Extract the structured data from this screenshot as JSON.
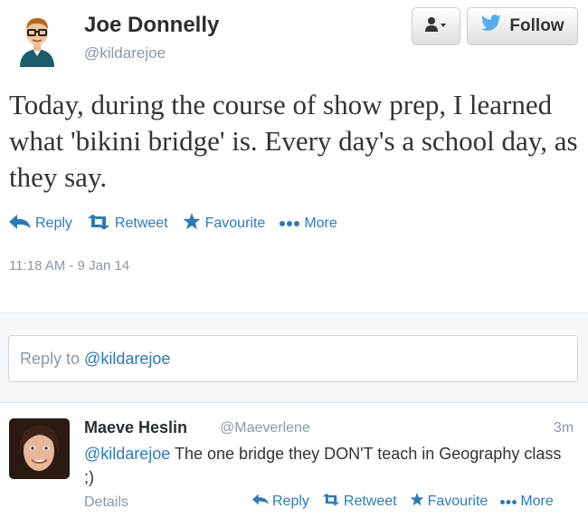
{
  "author": {
    "name": "Joe Donnelly",
    "handle": "@kildarejoe"
  },
  "buttons": {
    "follow_label": "Follow"
  },
  "tweet": {
    "text": "Today, during the course of show prep, I learned what 'bikini bridge' is. Every day's a school day, as they say.",
    "timestamp": "11:18 AM - 9 Jan 14"
  },
  "actions": {
    "reply": "Reply",
    "retweet": "Retweet",
    "favourite": "Favourite",
    "more": "More"
  },
  "reply_box": {
    "prefix": "Reply to",
    "mention": "@kildarejoe"
  },
  "reply_tweet": {
    "name": "Maeve Heslin",
    "handle": "@Maeverlene",
    "time": "3m",
    "mention": "@kildarejoe",
    "text": " The one bridge they DON'T teach in Geography class ;)",
    "details": "Details"
  },
  "colors": {
    "link": "#2b7bb9",
    "muted": "#8899a6",
    "twitter_blue": "#55acee"
  },
  "icons": [
    "user-dropdown-icon",
    "twitter-bird-icon",
    "reply-icon",
    "retweet-icon",
    "favourite-star-icon",
    "more-dots-icon"
  ]
}
